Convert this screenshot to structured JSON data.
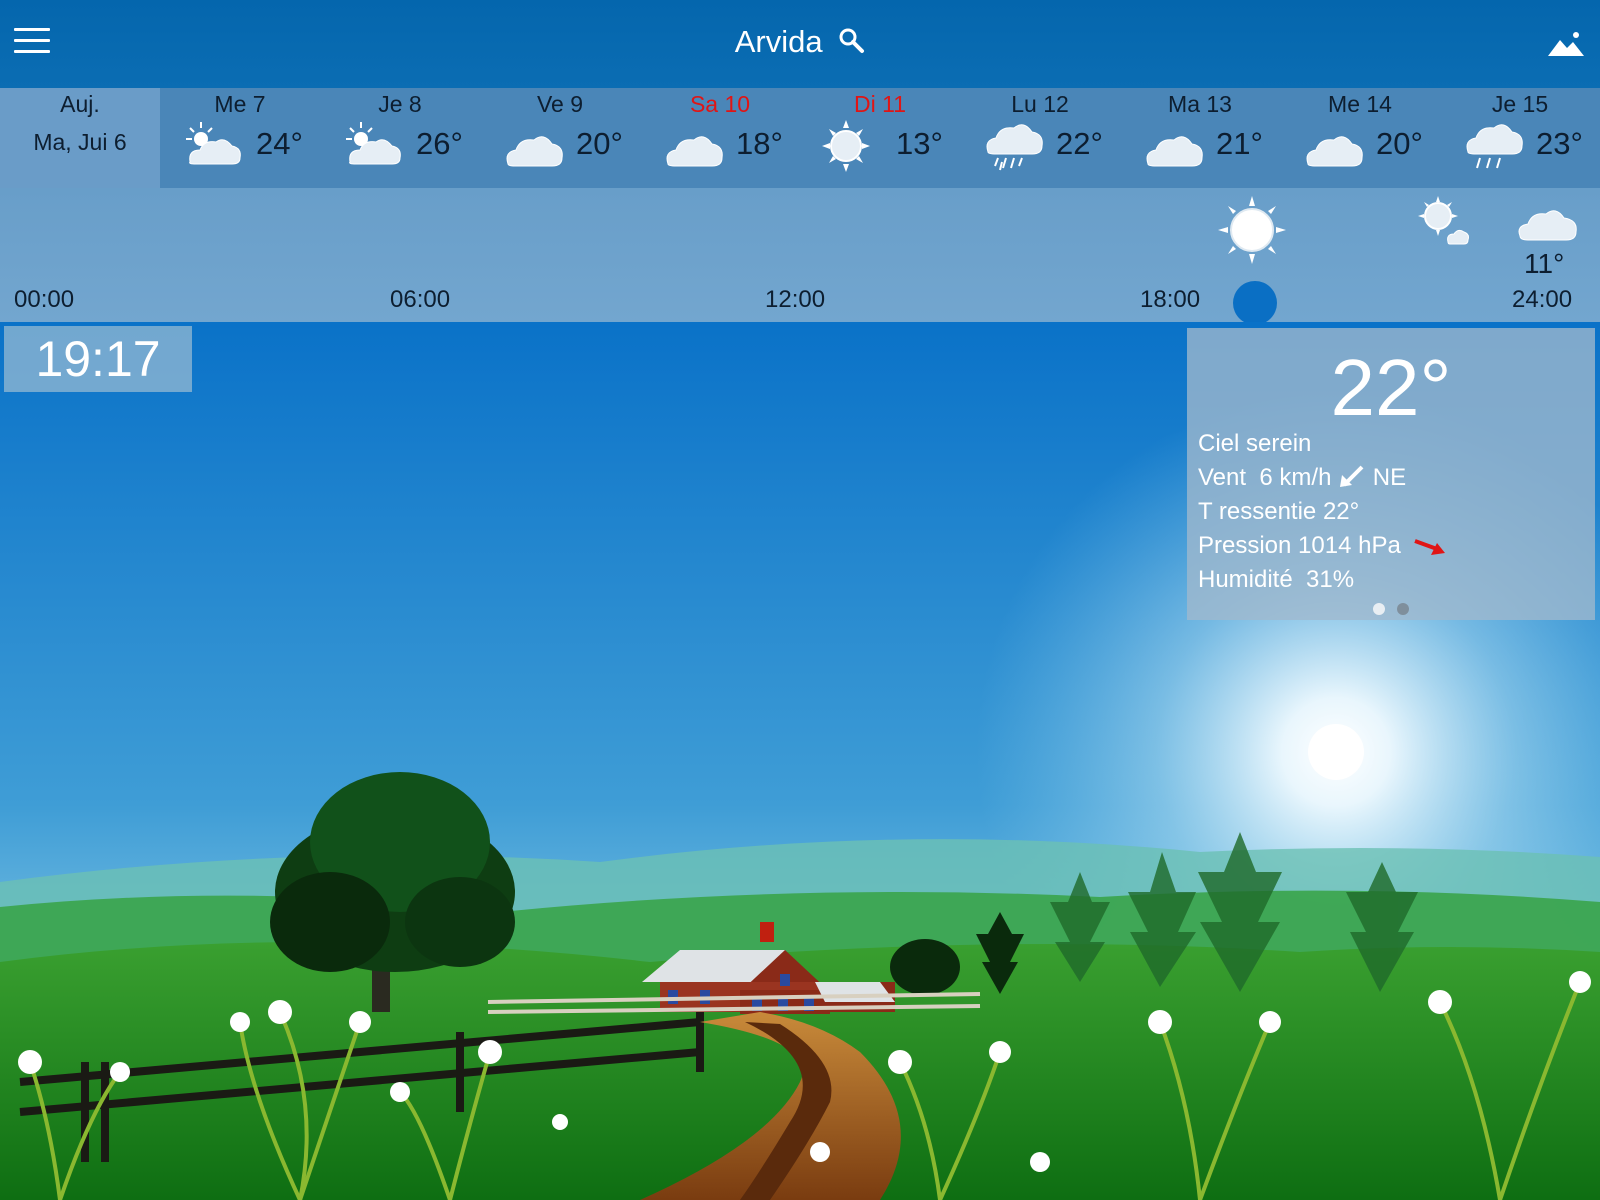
{
  "header": {
    "city": "Arvida",
    "menu_icon": "hamburger-icon",
    "search_icon": "search-icon",
    "landscape_icon": "mountain-icon"
  },
  "days": [
    {
      "line1": "Auj.",
      "line2": "Ma, Jui 6",
      "today": true
    },
    {
      "name": "Me 7",
      "temp": "24°",
      "icon": "partly-cloudy-icon",
      "weekend": false
    },
    {
      "name": "Je 8",
      "temp": "26°",
      "icon": "partly-cloudy-icon",
      "weekend": false
    },
    {
      "name": "Ve 9",
      "temp": "20°",
      "icon": "cloud-icon",
      "weekend": false
    },
    {
      "name": "Sa 10",
      "temp": "18°",
      "icon": "cloud-icon",
      "weekend": true
    },
    {
      "name": "Di 11",
      "temp": "13°",
      "icon": "sun-icon",
      "weekend": true
    },
    {
      "name": "Lu 12",
      "temp": "22°",
      "icon": "rain-cloud-icon",
      "weekend": false
    },
    {
      "name": "Ma 13",
      "temp": "21°",
      "icon": "cloud-icon",
      "weekend": false
    },
    {
      "name": "Me 14",
      "temp": "20°",
      "icon": "cloud-icon",
      "weekend": false
    },
    {
      "name": "Je 15",
      "temp": "23°",
      "icon": "rain-cloud-icon",
      "weekend": false
    }
  ],
  "hourly": {
    "ticks": [
      "00:00",
      "06:00",
      "12:00",
      "18:00",
      "24:00"
    ],
    "last_temp": "11°",
    "icons": [
      "sun-icon",
      "sun-small-cloud-icon",
      "cloud-icon"
    ]
  },
  "clock": "19:17",
  "current": {
    "temp": "22°",
    "condition": "Ciel serein",
    "wind_label": "Vent",
    "wind_speed": "6 km/h",
    "wind_dir": "NE",
    "feels_like": "T ressentie 22°",
    "pressure": "Pression 1014 hPa",
    "humidity_label": "Humidité",
    "humidity_value": "31%",
    "pressure_trend_color": "#e01515"
  },
  "colors": {
    "accent": "#0a6fc4",
    "weekend": "#e01515"
  }
}
